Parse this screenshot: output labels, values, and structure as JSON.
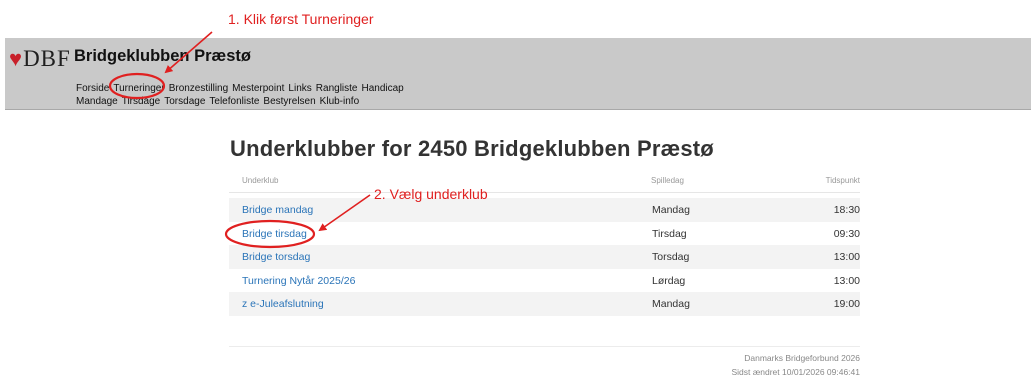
{
  "annotations": {
    "step1": "1. Klik først Turneringer",
    "step2": "2. Vælg underklub",
    "color": "#e02020"
  },
  "header": {
    "logo_text": "DBF",
    "site_title": "Bridgeklubben Præstø",
    "nav_row1": [
      "Forside",
      "Turneringer",
      "Bronzestilling",
      "Mesterpoint",
      "Links",
      "Rangliste",
      "Handicap"
    ],
    "nav_row2": [
      "Mandage",
      "Tirsdage",
      "Torsdage",
      "Telefonliste",
      "Bestyrelsen",
      "Klub-info"
    ]
  },
  "main": {
    "title": "Underklubber for 2450 Bridgeklubben Præstø",
    "columns": [
      "Underklub",
      "Spilledag",
      "Tidspunkt"
    ],
    "rows": [
      {
        "name": "Bridge mandag",
        "day": "Mandag",
        "time": "18:30"
      },
      {
        "name": "Bridge tirsdag",
        "day": "Tirsdag",
        "time": "09:30"
      },
      {
        "name": "Bridge torsdag",
        "day": "Torsdag",
        "time": "13:00"
      },
      {
        "name": "Turnering Nytår 2025/26",
        "day": "Lørdag",
        "time": "13:00"
      },
      {
        "name": "z e-Juleafslutning",
        "day": "Mandag",
        "time": "19:00"
      }
    ]
  },
  "footer": {
    "line1": "Danmarks Bridgeforbund 2026",
    "line2": "Sidst ændret 10/01/2026 09:46:41"
  },
  "colors": {
    "header_bg": "#c9c9c9",
    "link": "#2a74b8",
    "logo_suit": "#c8202a"
  }
}
